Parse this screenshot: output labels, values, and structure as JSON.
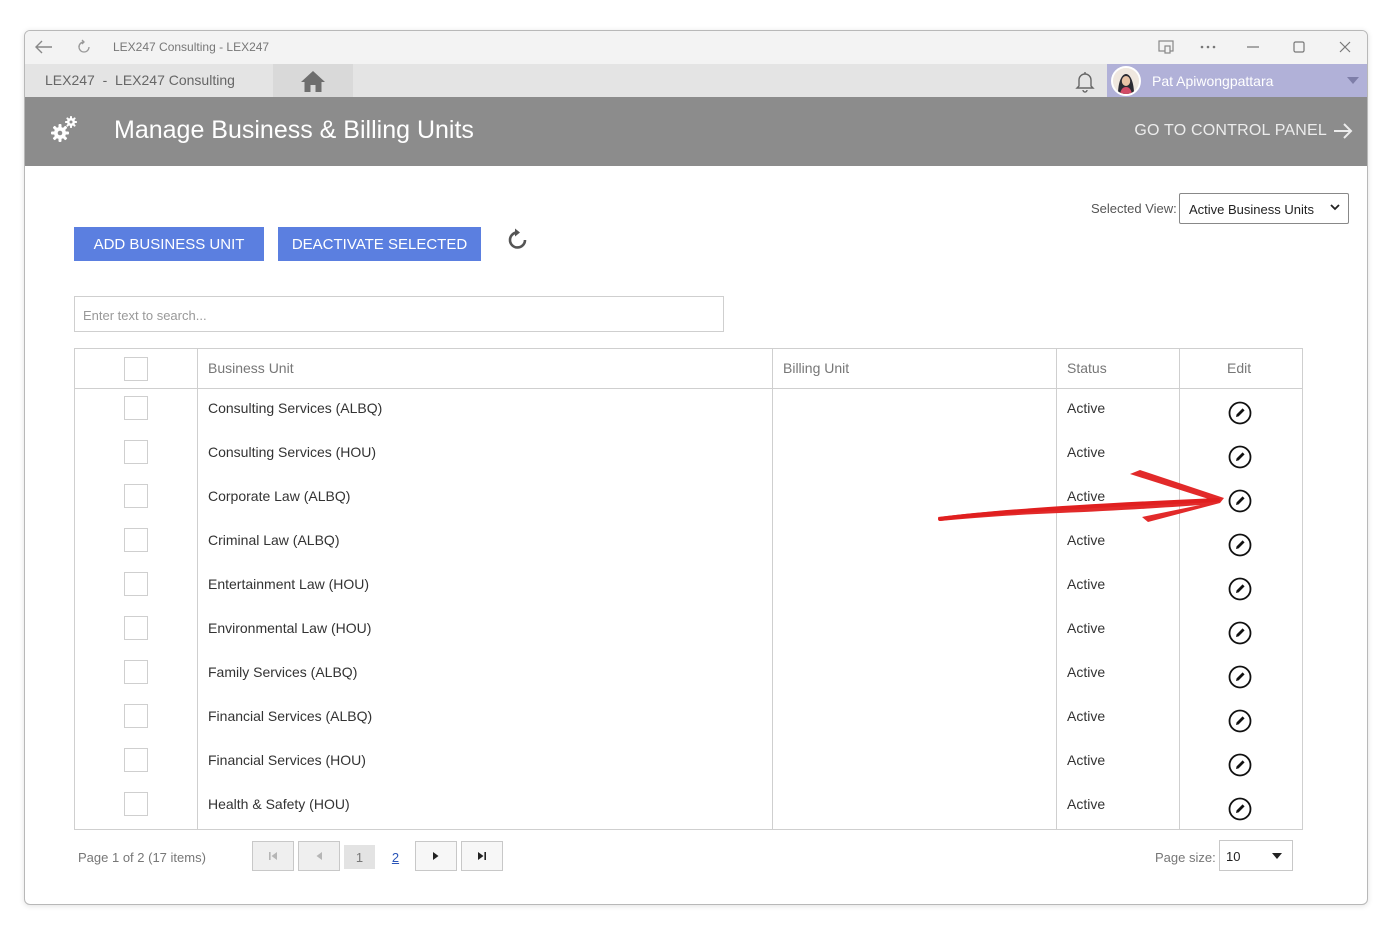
{
  "window": {
    "title": "LEX247 Consulting - LEX247"
  },
  "appbar": {
    "breadcrumb": "LEX247  -  LEX247 Consulting",
    "user_name": "Pat Apiwongpattara"
  },
  "header": {
    "title": "Manage Business & Billing Units",
    "control_panel_label": "GO TO CONTROL PANEL"
  },
  "toolbar": {
    "selected_view_label": "Selected View:",
    "selected_view_value": "Active Business Units",
    "add_label": "ADD BUSINESS UNIT",
    "deactivate_label": "DEACTIVATE SELECTED"
  },
  "search": {
    "placeholder": "Enter text to search..."
  },
  "grid": {
    "columns": {
      "business_unit": "Business Unit",
      "billing_unit": "Billing Unit",
      "status": "Status",
      "edit": "Edit"
    },
    "rows": [
      {
        "business_unit": "Consulting Services (ALBQ)",
        "billing_unit": "",
        "status": "Active"
      },
      {
        "business_unit": "Consulting Services (HOU)",
        "billing_unit": "",
        "status": "Active"
      },
      {
        "business_unit": "Corporate Law (ALBQ)",
        "billing_unit": "",
        "status": "Active"
      },
      {
        "business_unit": "Criminal Law (ALBQ)",
        "billing_unit": "",
        "status": "Active"
      },
      {
        "business_unit": "Entertainment Law (HOU)",
        "billing_unit": "",
        "status": "Active"
      },
      {
        "business_unit": "Environmental Law (HOU)",
        "billing_unit": "",
        "status": "Active"
      },
      {
        "business_unit": "Family Services (ALBQ)",
        "billing_unit": "",
        "status": "Active"
      },
      {
        "business_unit": "Financial Services (ALBQ)",
        "billing_unit": "",
        "status": "Active"
      },
      {
        "business_unit": "Financial Services (HOU)",
        "billing_unit": "",
        "status": "Active"
      },
      {
        "business_unit": "Health & Safety (HOU)",
        "billing_unit": "",
        "status": "Active"
      }
    ]
  },
  "pager": {
    "info": "Page 1 of 2 (17 items)",
    "current_page": "1",
    "next_page": "2",
    "page_size_label": "Page size:",
    "page_size_value": "10"
  },
  "colors": {
    "accent_button": "#5b7fe0",
    "header_bar": "#8c8c8c",
    "user_bar": "#b1b1d8",
    "annotation_arrow": "#e01f1f"
  },
  "icons": [
    "back-icon",
    "reload-icon",
    "screen-cast-icon",
    "more-icon",
    "minimize-icon",
    "maximize-icon",
    "close-icon",
    "home-icon",
    "bell-icon",
    "gears-icon",
    "arrow-right-icon",
    "refresh-icon",
    "edit-icon",
    "first-page-icon",
    "prev-page-icon",
    "next-page-icon",
    "last-page-icon"
  ]
}
